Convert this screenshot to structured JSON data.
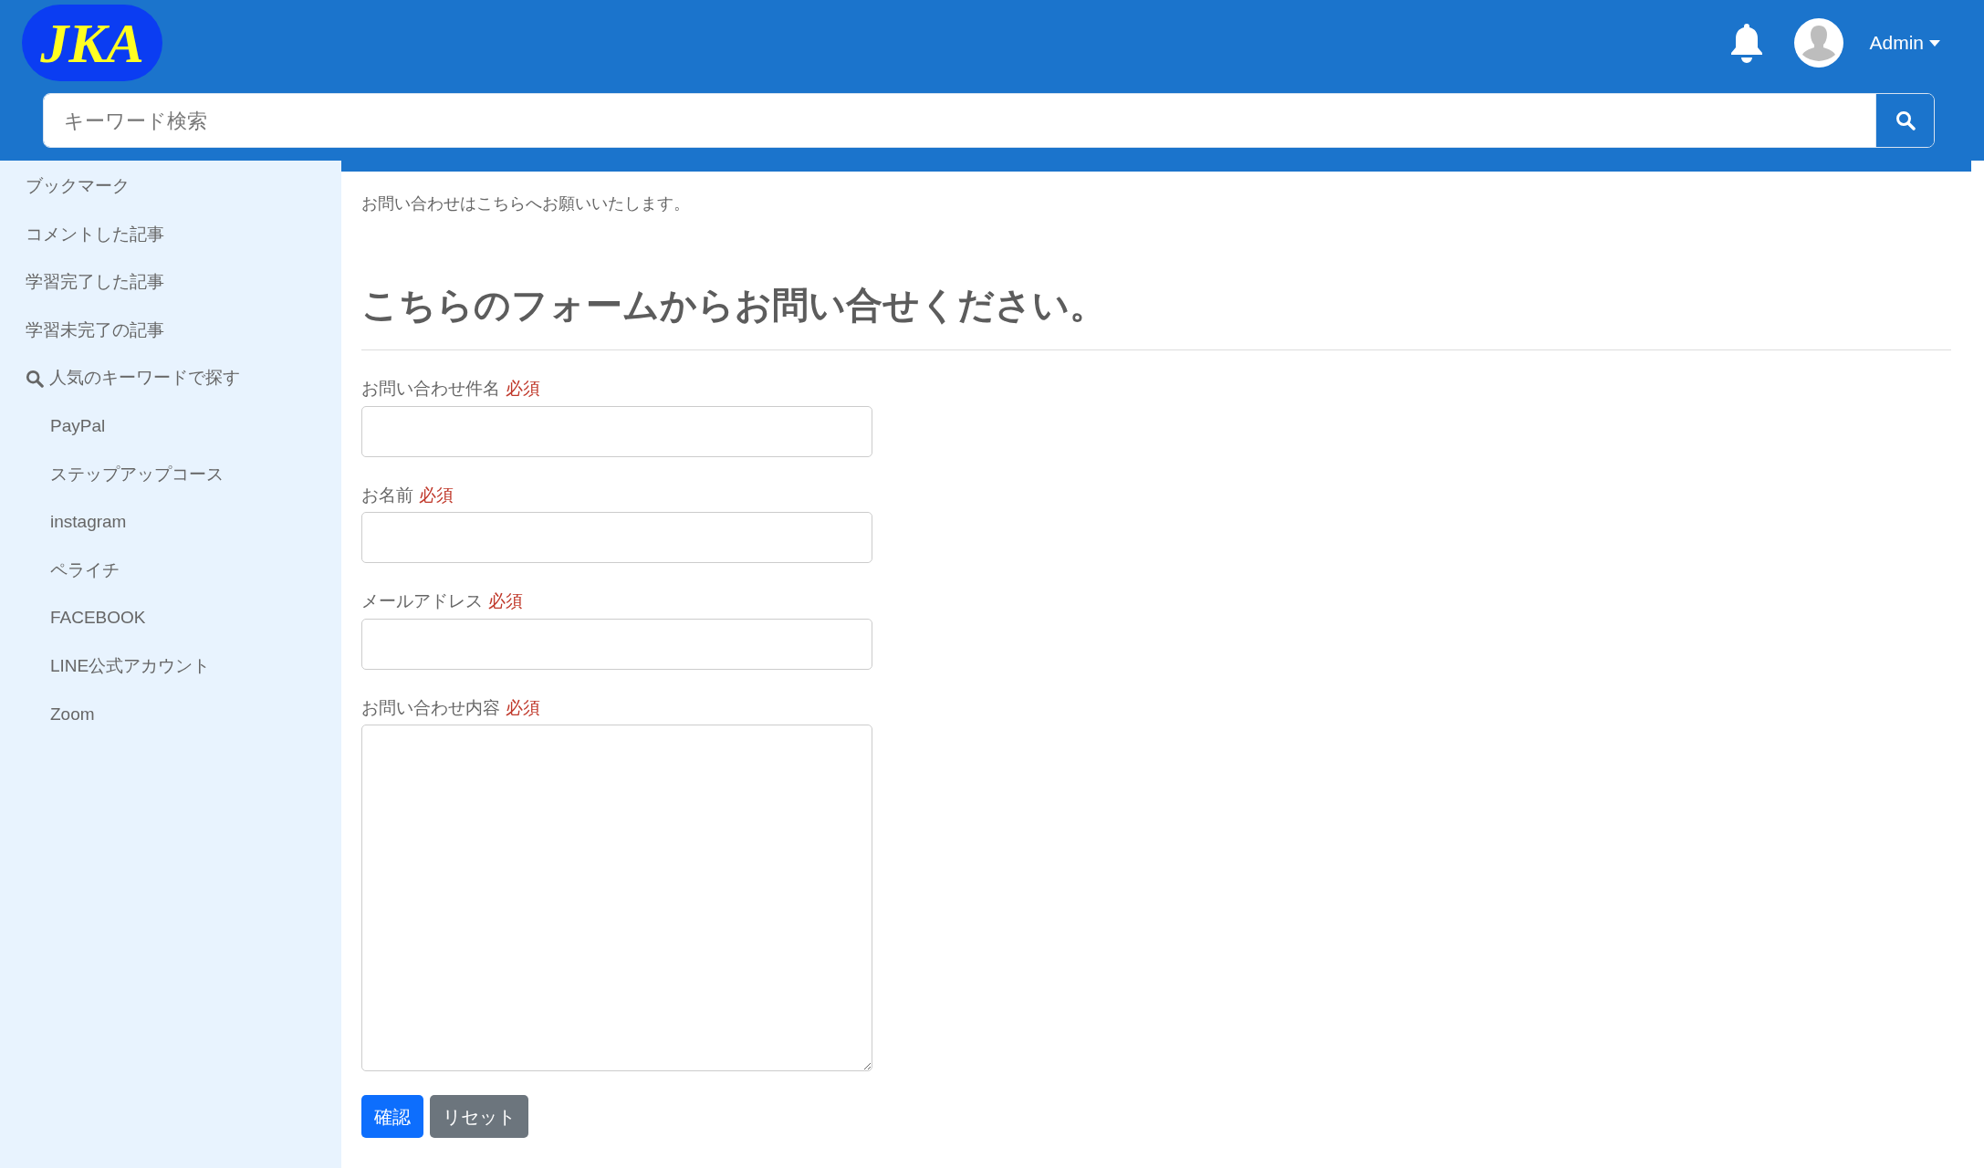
{
  "header": {
    "logo": "JKA",
    "user": "Admin",
    "search": {
      "placeholder": "キーワード検索"
    }
  },
  "sidebar": {
    "items": [
      {
        "kind": "link",
        "label": "ブックマーク"
      },
      {
        "kind": "link",
        "label": "コメントした記事"
      },
      {
        "kind": "link",
        "label": "学習完了した記事"
      },
      {
        "kind": "link",
        "label": "学習未完了の記事"
      },
      {
        "kind": "search",
        "label": "人気のキーワードで探す",
        "children": [
          {
            "label": "PayPal"
          },
          {
            "label": "ステップアップコース"
          },
          {
            "label": "instagram"
          },
          {
            "label": "ペライチ"
          },
          {
            "label": "FACEBOOK"
          },
          {
            "label": "LINE公式アカウント"
          },
          {
            "label": "Zoom"
          }
        ]
      }
    ]
  },
  "content": {
    "intro": "お問い合わせはこちらへお願いいたします。",
    "heading": "こちらのフォームからお問い合せください。",
    "fields": [
      {
        "kind": "text",
        "label": "お問い合わせ件名",
        "required": "必須"
      },
      {
        "kind": "text",
        "label": "お名前",
        "required": "必須"
      },
      {
        "kind": "text",
        "label": "メールアドレス",
        "required": "必須"
      },
      {
        "kind": "textarea",
        "label": "お問い合わせ内容",
        "required": "必須"
      }
    ],
    "buttons": [
      {
        "kind": "primary",
        "label": "確認"
      },
      {
        "kind": "secondary",
        "label": "リセット"
      }
    ]
  }
}
